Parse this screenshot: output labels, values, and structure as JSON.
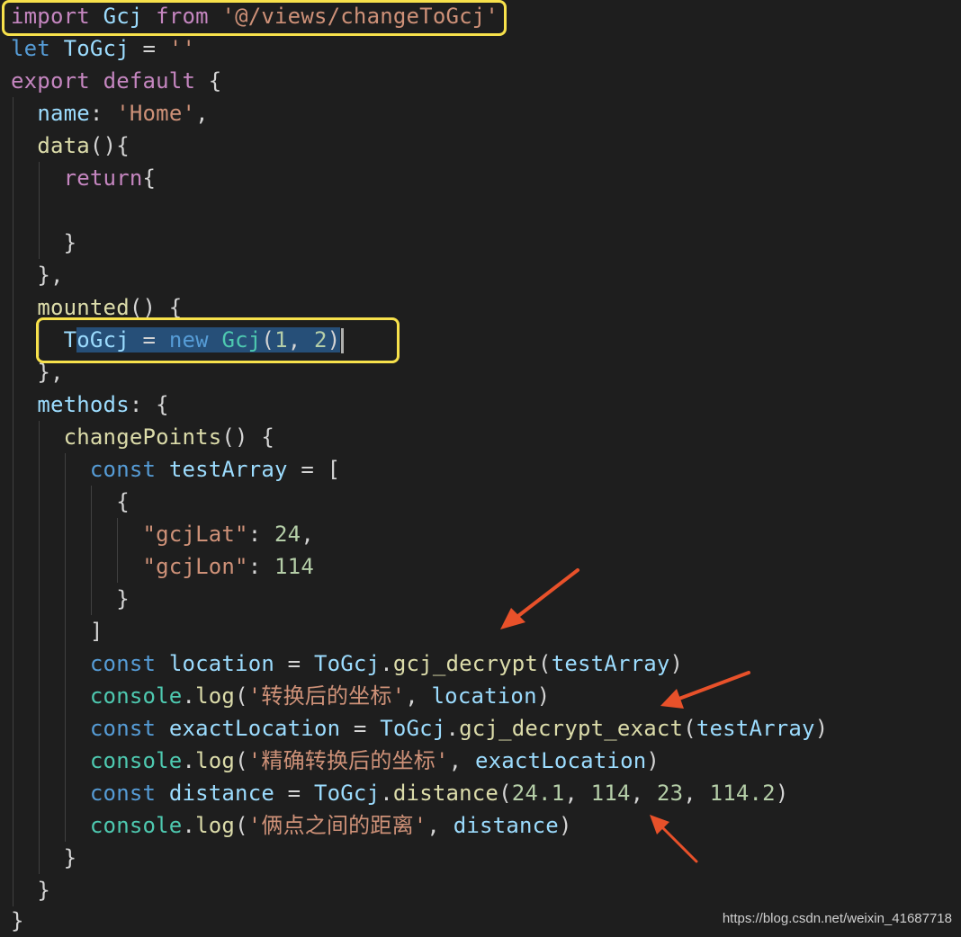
{
  "code": {
    "l1": {
      "kw": "import",
      "name": "Gcj",
      "from": "from",
      "path": "'@/views/changeToGcj'"
    },
    "l2": {
      "kw": "let",
      "name": "ToGcj",
      "eq": "=",
      "val": "''"
    },
    "l3": {
      "kw1": "export",
      "kw2": "default",
      "brace": "{"
    },
    "l4": {
      "prop": "name",
      "colon": ":",
      "val": "'Home'",
      "comma": ","
    },
    "l5": {
      "fn": "data",
      "rest": "(){"
    },
    "l6": {
      "kw": "return",
      "brace": "{"
    },
    "l7": {
      "text": "}"
    },
    "l8": {
      "text": "},"
    },
    "l9": {
      "fn": "mounted",
      "rest": "() {"
    },
    "l10": {
      "var": "ToGcj",
      "eq": "=",
      "kw": "new",
      "cls": "Gcj",
      "open": "(",
      "a": "1",
      "comma": ",",
      "b": "2",
      "close": ")"
    },
    "l11": {
      "text": "},"
    },
    "l12": {
      "prop": "methods",
      "rest": ": {"
    },
    "l13": {
      "fn": "changePoints",
      "rest": "() {"
    },
    "l14": {
      "kw": "const",
      "var": "testArray",
      "rest": "= ["
    },
    "l15": {
      "text": "{"
    },
    "l16": {
      "key": "\"gcjLat\"",
      "colon": ":",
      "val": "24",
      "comma": ","
    },
    "l17": {
      "key": "\"gcjLon\"",
      "colon": ":",
      "val": "114"
    },
    "l18": {
      "text": "}"
    },
    "l19": {
      "text": "]"
    },
    "l20": {
      "kw": "const",
      "var": "location",
      "eq": "=",
      "obj": "ToGcj",
      "dot": ".",
      "fn": "gcj_decrypt",
      "open": "(",
      "arg": "testArray",
      "close": ")"
    },
    "l21": {
      "obj": "console",
      "dot": ".",
      "fn": "log",
      "open": "(",
      "str": "'转换后的坐标'",
      "comma": ",",
      "arg": "location",
      "close": ")"
    },
    "l22": {
      "kw": "const",
      "var": "exactLocation",
      "eq": "=",
      "obj": "ToGcj",
      "dot": ".",
      "fn": "gcj_decrypt_exact",
      "open": "(",
      "arg": "testArray",
      "close": ")"
    },
    "l23": {
      "obj": "console",
      "dot": ".",
      "fn": "log",
      "open": "(",
      "str": "'精确转换后的坐标'",
      "comma": ",",
      "arg": "exactLocation",
      "close": ")"
    },
    "l24": {
      "kw": "const",
      "var": "distance",
      "eq": "=",
      "obj": "ToGcj",
      "dot": ".",
      "fn": "distance",
      "open": "(",
      "n1": "24.1",
      "n2": "114",
      "n3": "23",
      "n4": "114.2",
      "c": ",",
      "close": ")"
    },
    "l25": {
      "obj": "console",
      "dot": ".",
      "fn": "log",
      "open": "(",
      "str": "'俩点之间的距离'",
      "comma": ",",
      "arg": "distance",
      "close": ")"
    },
    "l26": {
      "text": "}"
    },
    "l27": {
      "text": "}"
    },
    "l28": {
      "text": "}"
    }
  },
  "watermark": "https://blog.csdn.net/weixin_41687718",
  "colors": {
    "highlight_box": "#f7e14b",
    "arrow": "#e8512a",
    "selection": "#264f78"
  }
}
